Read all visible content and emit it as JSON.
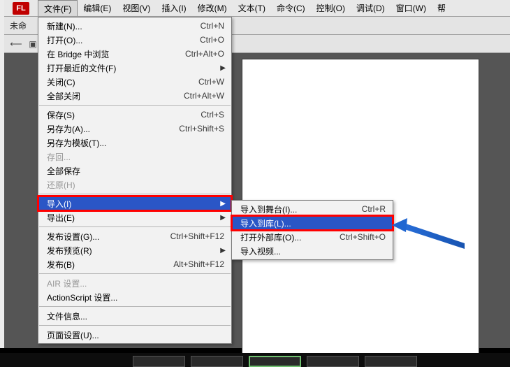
{
  "logo": "FL",
  "menubar": {
    "file": "文件(F)",
    "edit": "编辑(E)",
    "view": "视图(V)",
    "insert": "插入(I)",
    "modify": "修改(M)",
    "text": "文本(T)",
    "commands": "命令(C)",
    "control": "控制(O)",
    "debug": "调试(D)",
    "window": "窗口(W)",
    "help_partial": "帮"
  },
  "title_prefix": "未命",
  "file_menu": {
    "new": {
      "label": "新建(N)...",
      "shortcut": "Ctrl+N"
    },
    "open": {
      "label": "打开(O)...",
      "shortcut": "Ctrl+O"
    },
    "browse_bridge": {
      "label": "在 Bridge 中浏览",
      "shortcut": "Ctrl+Alt+O"
    },
    "open_recent": {
      "label": "打开最近的文件(F)"
    },
    "close": {
      "label": "关闭(C)",
      "shortcut": "Ctrl+W"
    },
    "close_all": {
      "label": "全部关闭",
      "shortcut": "Ctrl+Alt+W"
    },
    "save": {
      "label": "保存(S)",
      "shortcut": "Ctrl+S"
    },
    "save_as": {
      "label": "另存为(A)...",
      "shortcut": "Ctrl+Shift+S"
    },
    "save_as_template": {
      "label": "另存为模板(T)..."
    },
    "checkin": {
      "label": "存回..."
    },
    "save_all": {
      "label": "全部保存"
    },
    "revert": {
      "label": "还原(H)"
    },
    "import": {
      "label": "导入(I)"
    },
    "export": {
      "label": "导出(E)"
    },
    "publish_settings": {
      "label": "发布设置(G)...",
      "shortcut": "Ctrl+Shift+F12"
    },
    "publish_preview": {
      "label": "发布预览(R)"
    },
    "publish": {
      "label": "发布(B)",
      "shortcut": "Alt+Shift+F12"
    },
    "air_settings": {
      "label": "AIR 设置..."
    },
    "as_settings": {
      "label": "ActionScript 设置..."
    },
    "file_info": {
      "label": "文件信息..."
    },
    "page_setup": {
      "label": "页面设置(U)..."
    }
  },
  "import_submenu": {
    "to_stage": {
      "label": "导入到舞台(I)...",
      "shortcut": "Ctrl+R"
    },
    "to_library": {
      "label": "导入到库(L)..."
    },
    "open_external": {
      "label": "打开外部库(O)...",
      "shortcut": "Ctrl+Shift+O"
    },
    "import_video": {
      "label": "导入视频..."
    }
  },
  "colors": {
    "highlight": "#2a56c6",
    "red_box": "#ff0000",
    "arrow": "#1f66d1"
  }
}
